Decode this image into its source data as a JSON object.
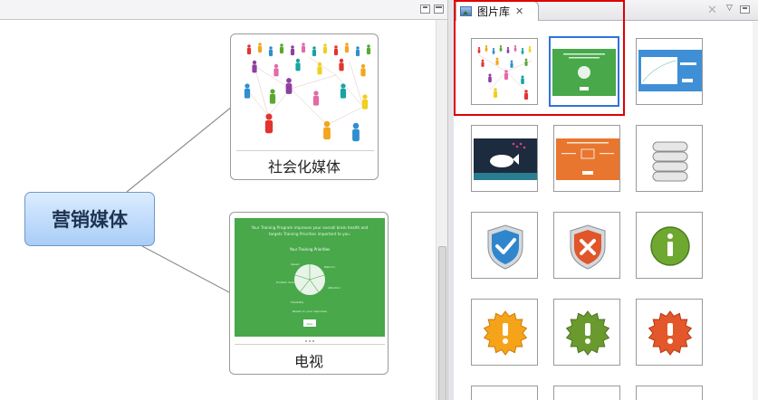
{
  "editor": {
    "central_topic": "营销媒体",
    "cards": [
      {
        "label": "社会化媒体",
        "image": "social-network-people"
      },
      {
        "label": "电视",
        "image": "green-slide-presentation"
      }
    ],
    "tv_slide": {
      "headline": "Your Training Program improves your overall brain health and targets Training Priorities important to you.",
      "subtitle": "Your Training Priorities",
      "labels": [
        "Speed",
        "Memory",
        "Problem Solving",
        "Attention",
        "Flexibility"
      ],
      "footer": "Based on your responses",
      "button": "Next"
    }
  },
  "gallery": {
    "tab_label": "图片库",
    "tab_close": "✕",
    "close_all_icon": "✕",
    "menu_icon": "▽",
    "items": [
      {
        "name": "social-network-people",
        "selected": false
      },
      {
        "name": "green-slide",
        "selected": true
      },
      {
        "name": "blue-chart-slide",
        "selected": false
      },
      {
        "name": "navy-whale-slide",
        "selected": false
      },
      {
        "name": "orange-slide",
        "selected": false
      },
      {
        "name": "database-icon",
        "selected": false
      },
      {
        "name": "shield-check-icon",
        "selected": false
      },
      {
        "name": "shield-x-icon",
        "selected": false
      },
      {
        "name": "info-icon",
        "selected": false
      },
      {
        "name": "warning-badge-orange-icon",
        "selected": false
      },
      {
        "name": "warning-badge-green-icon",
        "selected": false
      },
      {
        "name": "warning-badge-red-icon",
        "selected": false
      }
    ]
  },
  "colors": {
    "selection": "#2f73d8",
    "highlight": "#e00000",
    "topic_fill": "#a9cdf7",
    "slide_green": "#48a84a"
  }
}
